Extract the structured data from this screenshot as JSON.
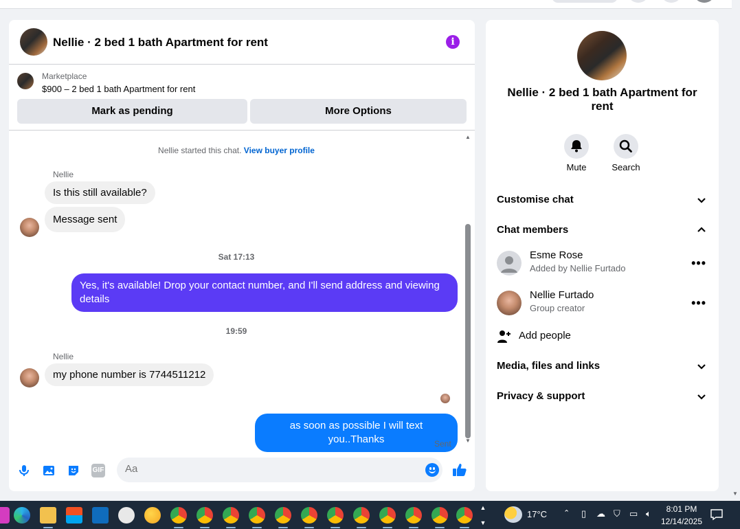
{
  "chat": {
    "title": "Nellie · 2 bed 1 bath Apartment for rent",
    "info_icon": "i",
    "listing": {
      "source": "Marketplace",
      "price_title": "$900 – 2 bed 1 bath Apartment for rent",
      "pending_button": "Mark as pending",
      "more_button": "More Options"
    },
    "started_text": "Nellie started this chat.",
    "buyer_profile_link": "View buyer profile",
    "messages": [
      {
        "sender": "Nellie",
        "text": "Is this still available?"
      },
      {
        "text": "Message sent"
      },
      {
        "timestamp": "Sat 17:13"
      },
      {
        "text": "Yes, it's available! Drop your contact number, and I'll send address and viewing details"
      },
      {
        "timestamp": "19:59"
      },
      {
        "sender": "Nellie",
        "text": "my phone number is 7744511212"
      },
      {
        "text": "as soon as possible I will text you..Thanks"
      },
      {
        "status": "Sent"
      }
    ],
    "composer": {
      "placeholder": "Aa",
      "gif_label": "GIF"
    }
  },
  "side": {
    "title": "Nellie · 2 bed 1 bath Apartment for rent",
    "actions": [
      {
        "label": "Mute",
        "icon": "bell-icon"
      },
      {
        "label": "Search",
        "icon": "search-icon"
      }
    ],
    "sections": {
      "customise": "Customise chat",
      "members": "Chat members",
      "media": "Media, files and links",
      "privacy": "Privacy & support"
    },
    "members": [
      {
        "name": "Esme Rose",
        "sub": "Added by Nellie Furtado"
      },
      {
        "name": "Nellie Furtado",
        "sub": "Group creator"
      }
    ],
    "add_people": "Add people"
  },
  "taskbar": {
    "weather": "17°C",
    "time": "8:01 PM",
    "date": "12/14/2025"
  },
  "colors": {
    "accent_blue": "#0a7cff",
    "purple_bubble": "#5b3bf5",
    "info_purple": "#9b1fe8",
    "link": "#0064d1"
  }
}
